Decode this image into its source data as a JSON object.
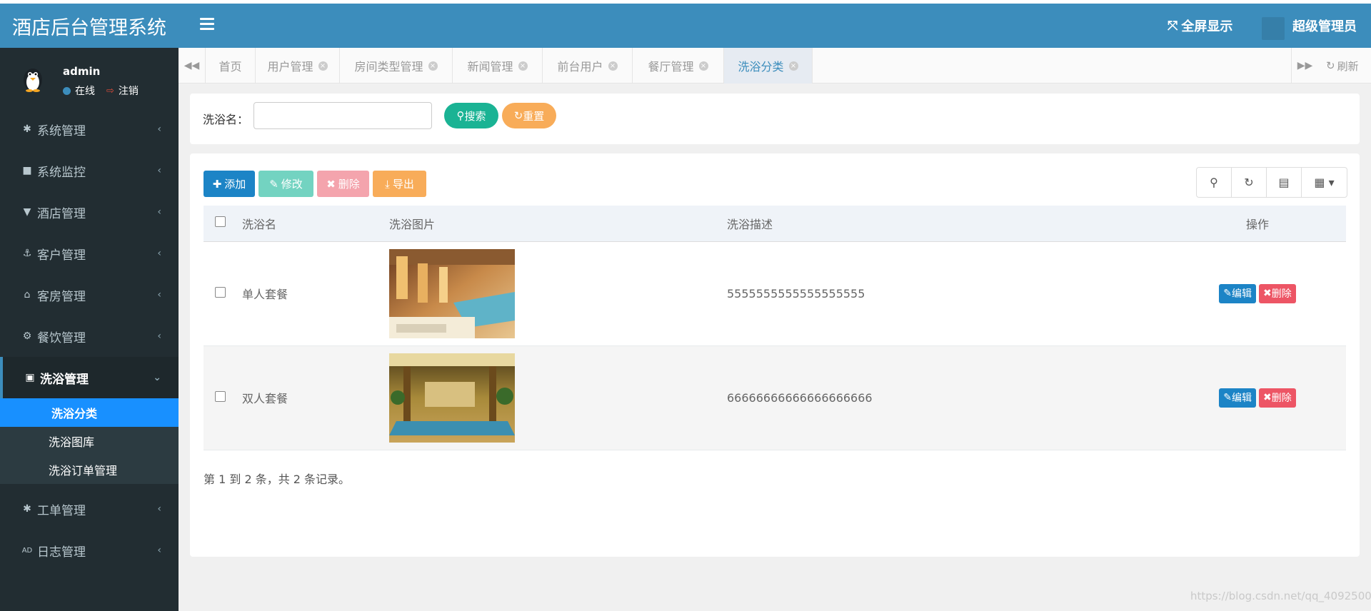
{
  "app": {
    "title": "酒店后台管理系统"
  },
  "header": {
    "fullscreen_label": "全屏显示",
    "user_label": "超级管理员"
  },
  "user_panel": {
    "name": "admin",
    "status": "在线",
    "logout": "注销"
  },
  "sidebar": {
    "items": [
      {
        "label": "系统管理",
        "icon": "gear-icon"
      },
      {
        "label": "系统监控",
        "icon": "video-camera-icon"
      },
      {
        "label": "酒店管理",
        "icon": "filter-icon"
      },
      {
        "label": "客户管理",
        "icon": "anchor-icon"
      },
      {
        "label": "客房管理",
        "icon": "bank-icon"
      },
      {
        "label": "餐饮管理",
        "icon": "gears-icon"
      },
      {
        "label": "洗浴管理",
        "icon": "id-card-icon"
      },
      {
        "label": "工单管理",
        "icon": "asterisk-icon"
      },
      {
        "label": "日志管理",
        "icon": "ad-icon"
      }
    ],
    "sub_items": [
      "洗浴分类",
      "洗浴图库",
      "洗浴订单管理"
    ]
  },
  "tabs": {
    "items": [
      "首页",
      "用户管理",
      "房间类型管理",
      "新闻管理",
      "前台用户",
      "餐厅管理",
      "洗浴分类"
    ],
    "refresh_label": "刷新"
  },
  "search": {
    "label": "洗浴名：",
    "value": "",
    "search_button": "搜索",
    "reset_button": "重置"
  },
  "toolbar": {
    "add": "添加",
    "edit": "修改",
    "delete": "删除",
    "export": "导出"
  },
  "table": {
    "headers": [
      "洗浴名",
      "洗浴图片",
      "洗浴描述",
      "操作"
    ],
    "rows": [
      {
        "name": "单人套餐",
        "desc": "5555555555555555555",
        "edit": "编辑",
        "delete": "删除"
      },
      {
        "name": "双人套餐",
        "desc": "66666666666666666666",
        "edit": "编辑",
        "delete": "删除"
      }
    ],
    "summary": "第 1 到 2 条，共 2 条记录。"
  },
  "watermark": "https://blog.csdn.net/qq_4092500",
  "colors": {
    "header": "#3c8dbc",
    "sidebar": "#222d32",
    "selected_sub": "#1890ff",
    "search_btn": "#1ab394",
    "reset_btn": "#f8ac59",
    "add_btn": "#1c84c6",
    "edit_btn": "#73d3c1",
    "delete_btn": "#f4a4ad",
    "export_btn": "#f8ac59"
  }
}
